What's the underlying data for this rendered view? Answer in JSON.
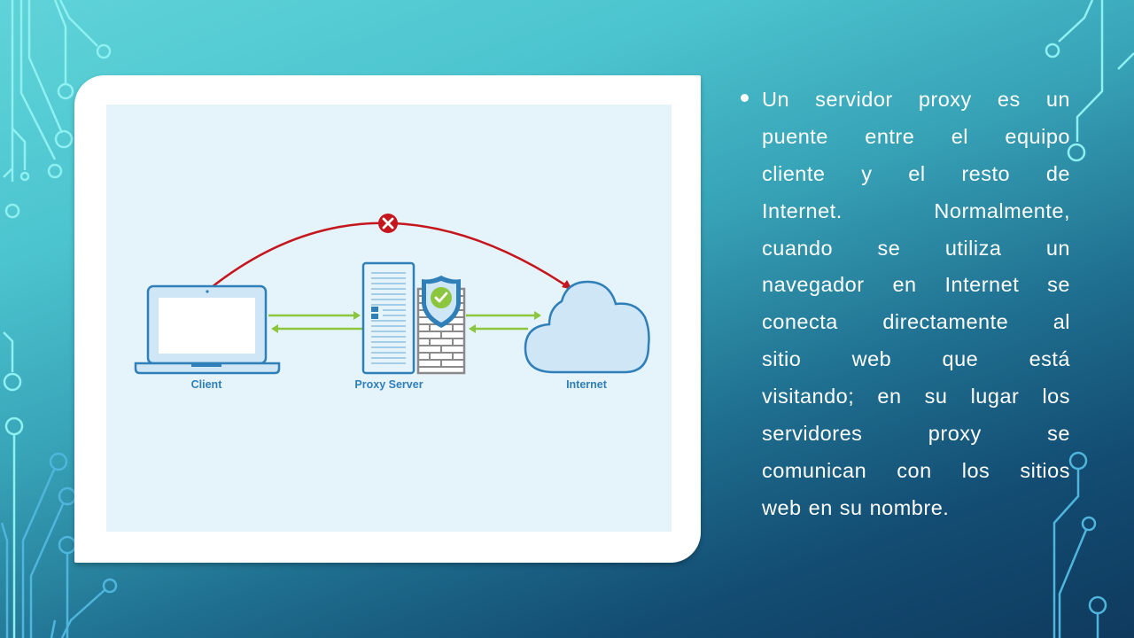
{
  "slide": {
    "diagram": {
      "labels": {
        "client": "Client",
        "proxy": "Proxy Server",
        "internet": "Internet"
      },
      "colors": {
        "primary_blue": "#2f7fb9",
        "arrow_green": "#8cc63f",
        "blocked_red": "#c4161c",
        "firewall_gray": "#8a8a8a",
        "shield_check_green": "#8cc63f"
      }
    },
    "bullet_text": {
      "full": "Un servidor proxy es un puente entre el equipo cliente y el resto de Internet. Normalmente, cuando se utiliza un navegador en Internet se conecta directamente al sitio web que está visitando; en su lugar los servidores proxy se comunican con los sitios web en su nombre.",
      "lines": [
        [
          "Un",
          "servidor",
          "proxy",
          "es",
          "un"
        ],
        [
          "puente",
          "entre",
          "el",
          "equipo"
        ],
        [
          "cliente",
          "y",
          "el",
          "resto",
          "de"
        ],
        [
          "Internet.",
          "Normalmente,"
        ],
        [
          "cuando",
          "se",
          "utiliza",
          "un"
        ],
        [
          "navegador",
          "en",
          "Internet",
          "se"
        ],
        [
          "conecta",
          "directamente",
          "al"
        ],
        [
          "sitio",
          "web",
          "que",
          "está"
        ],
        [
          "visitando;",
          "en",
          "su",
          "lugar",
          "los"
        ],
        [
          "servidores",
          "proxy",
          "se"
        ],
        [
          "comunican",
          "con",
          "los",
          "sitios"
        ],
        [
          "web",
          "en",
          "su",
          "nombre."
        ]
      ]
    }
  }
}
